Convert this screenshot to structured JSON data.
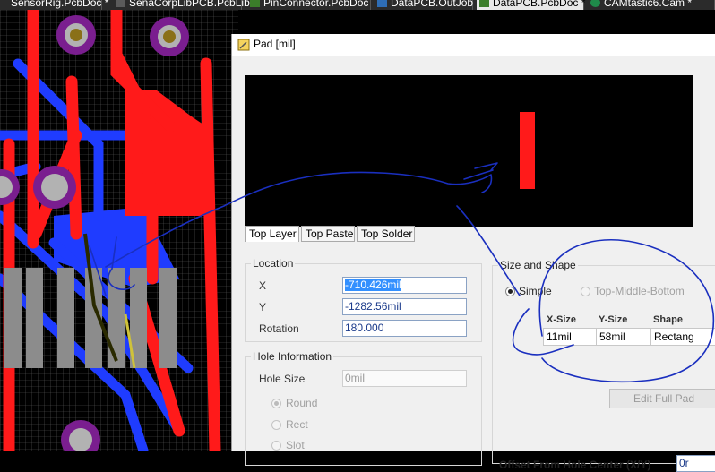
{
  "tabs": [
    {
      "label": "SensorRig.PcbDoc *",
      "active": false
    },
    {
      "label": "SenaCorpLibPCB.PcbLib",
      "active": false
    },
    {
      "label": "PinConnector.PcbDoc",
      "active": false
    },
    {
      "label": "DataPCB.OutJob",
      "active": false
    },
    {
      "label": "DataPCB.PcbDoc *",
      "active": true
    },
    {
      "label": "CAMtastic6.Cam *",
      "active": false
    }
  ],
  "dialog": {
    "title": "Pad [mil]",
    "layer_tabs": [
      "Top Layer",
      "Top Paste",
      "Top Solder"
    ],
    "location": {
      "label": "Location",
      "x_label": "X",
      "x_value": "-710.426mil",
      "y_label": "Y",
      "y_value": "-1282.56mil",
      "rotation_label": "Rotation",
      "rotation_value": "180.000"
    },
    "hole_info": {
      "label": "Hole Information",
      "hole_size_label": "Hole Size",
      "hole_size_value": "0mil",
      "shape_round": "Round",
      "shape_rect": "Rect",
      "shape_slot": "Slot"
    },
    "size_shape": {
      "label": "Size and Shape",
      "mode_simple": "Simple",
      "mode_tmb": "Top-Middle-Bottom",
      "col_xsize": "X-Size",
      "col_ysize": "Y-Size",
      "col_shape": "Shape",
      "xsize_value": "11mil",
      "ysize_value": "58mil",
      "shape_value": "Rectang",
      "edit_button": "Edit Full Pad"
    },
    "offset_label": "Offset From Hole Center (X/Y)",
    "offset_value": "0r"
  },
  "colors": {
    "pcb_top": "#ff1a1a",
    "pcb_bottom": "#1f3cff",
    "pad_ring": "#7a1e8f",
    "annotation": "#1a2fbf"
  }
}
